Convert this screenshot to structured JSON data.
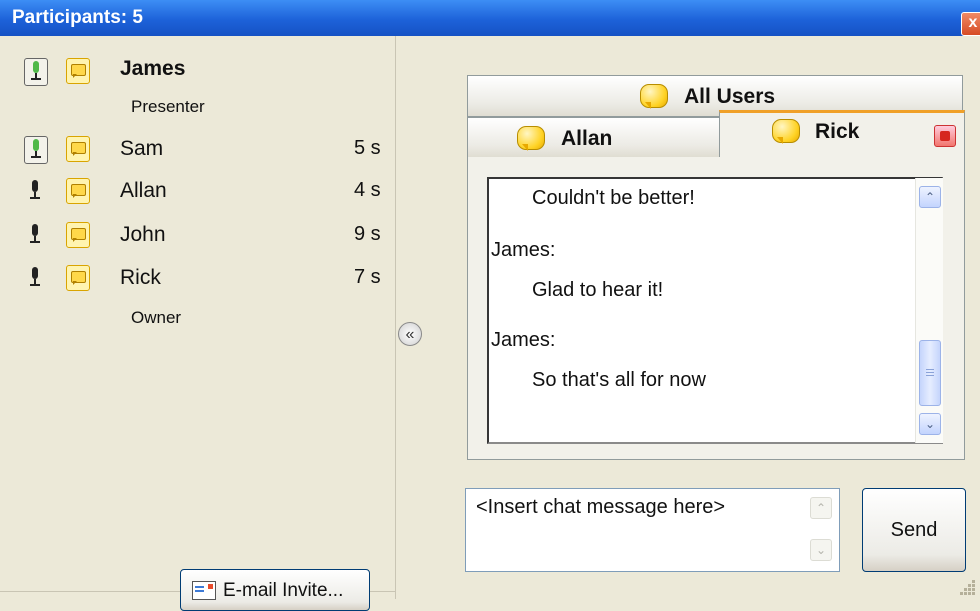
{
  "window": {
    "title": "Participants: 5",
    "close_glyph": "x"
  },
  "participants": [
    {
      "name": "James",
      "time": "",
      "role": "Presenter",
      "mic_icon": "microphone-active-icon",
      "chat_icon": "chat-icon"
    },
    {
      "name": "Sam",
      "time": "5 s",
      "role": "",
      "mic_icon": "microphone-active-icon",
      "chat_icon": "chat-icon"
    },
    {
      "name": "Allan",
      "time": "4 s",
      "role": "",
      "mic_icon": "microphone-icon",
      "chat_icon": "chat-icon"
    },
    {
      "name": "John",
      "time": "9 s",
      "role": "",
      "mic_icon": "microphone-icon",
      "chat_icon": "chat-icon"
    },
    {
      "name": "Rick",
      "time": "7 s",
      "role": "Owner",
      "mic_icon": "microphone-icon",
      "chat_icon": "chat-icon"
    }
  ],
  "email_invite": {
    "label": "E-mail Invite..."
  },
  "collapse": {
    "glyph": "«"
  },
  "tabs": {
    "all_users": "All Users",
    "allan": "Allan",
    "rick": "Rick"
  },
  "chat": {
    "messages": [
      {
        "author": "",
        "text": "Couldn't be better!"
      },
      {
        "author": "James:",
        "text": "Glad to hear it!"
      },
      {
        "author": "James:",
        "text": "So that's all for now"
      }
    ],
    "scroll_up": "⌃",
    "scroll_down": "⌄"
  },
  "message_input": {
    "placeholder": "<Insert chat message here>"
  },
  "send": {
    "label": "Send"
  },
  "colors": {
    "titlebar": "#1d62d9",
    "active_tab_accent": "#f0a028",
    "chat_bubble": "#ffd325",
    "close_red": "#d64b24"
  }
}
